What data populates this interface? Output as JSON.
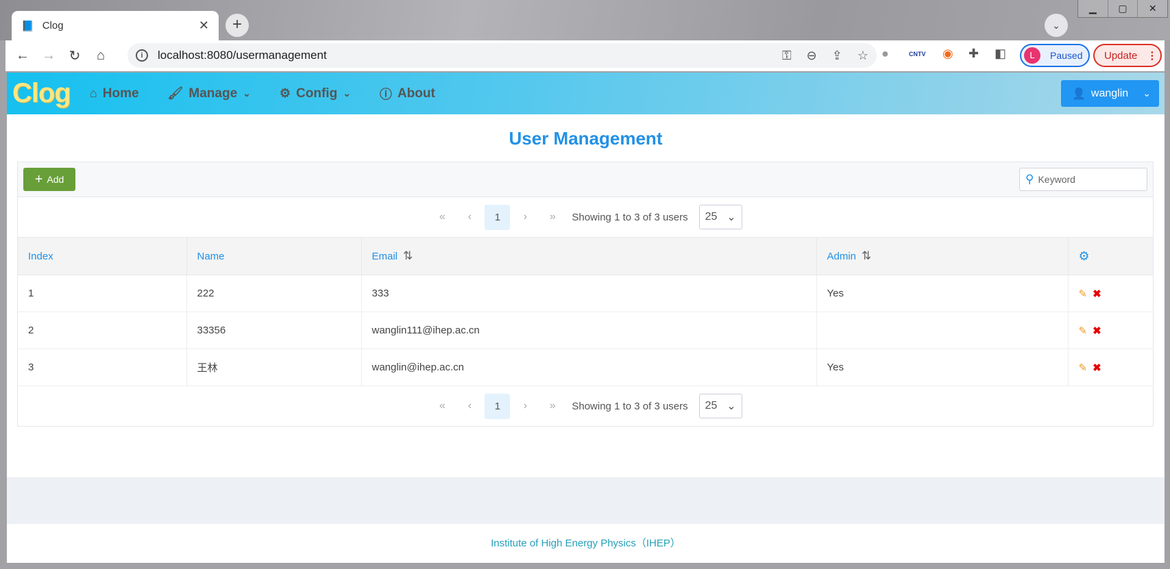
{
  "browser": {
    "tab_title": "Clog",
    "url_host": "localhost",
    "url_rest": ":8080/usermanagement",
    "profile_initial": "L",
    "profile_status": "Paused",
    "update_label": "Update"
  },
  "app": {
    "logo": "Clog",
    "nav": [
      {
        "label": "Home",
        "icon": "home-icon"
      },
      {
        "label": "Manage",
        "icon": "brush-icon"
      },
      {
        "label": "Config",
        "icon": "gear-icon"
      },
      {
        "label": "About",
        "icon": "info-icon"
      }
    ],
    "user": "wanglin"
  },
  "page": {
    "title": "User Management",
    "add_label": "Add",
    "search_placeholder": "Keyword"
  },
  "pagination": {
    "current": "1",
    "summary": "Showing 1 to 3 of 3 users",
    "page_size": "25"
  },
  "table": {
    "columns": [
      "Index",
      "Name",
      "Email",
      "Admin"
    ],
    "rows": [
      [
        "1",
        "222",
        "333",
        "Yes"
      ],
      [
        "2",
        "33356",
        "wanglin111@ihep.ac.cn",
        ""
      ],
      [
        "3",
        "王林",
        "wanglin@ihep.ac.cn",
        "Yes"
      ]
    ]
  },
  "footer": "Institute of High Energy Physics（IHEP）",
  "colors": {
    "accent": "#2291e6",
    "add": "#689f38",
    "edit": "#f29a1c",
    "delete": "#e50000"
  }
}
